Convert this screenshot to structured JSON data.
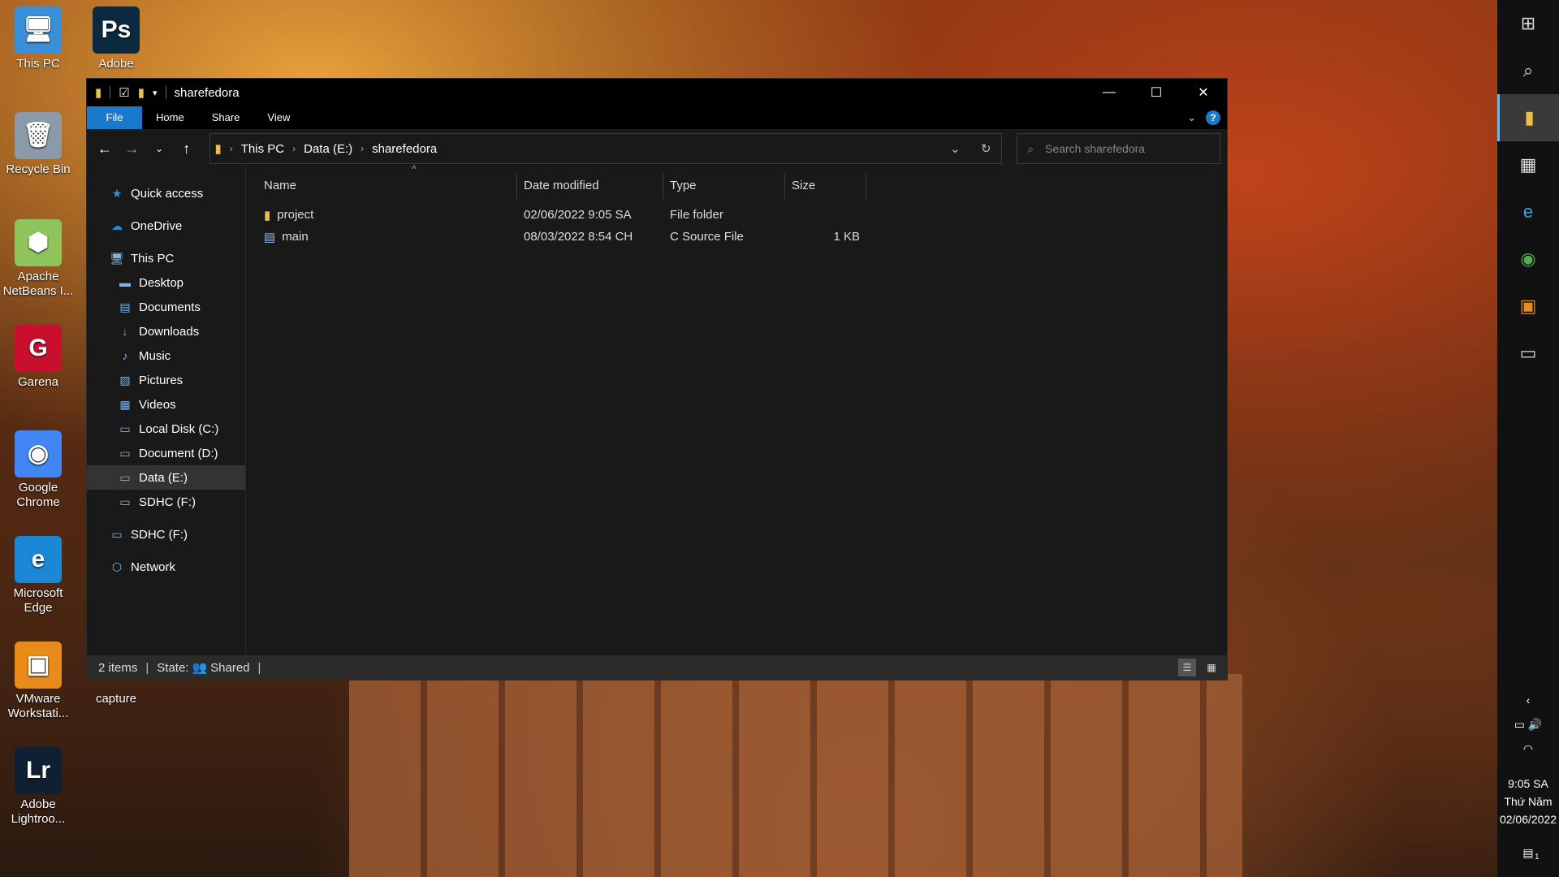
{
  "desktop": {
    "icons": [
      {
        "label": "This PC",
        "glyph": "🖥",
        "color": "#3b8fd8"
      },
      {
        "label": "Adobe",
        "glyph": "Ps",
        "color": "#0b2a3f"
      },
      {
        "label": "Recycle Bin",
        "glyph": "🗑",
        "color": "#8a9aa8"
      },
      {
        "label": "Apache NetBeans I...",
        "glyph": "⬢",
        "color": "#8fc45c"
      },
      {
        "label": "Garena",
        "glyph": "G",
        "color": "#c8102e"
      },
      {
        "label": "Google Chrome",
        "glyph": "◉",
        "color": "#4285f4"
      },
      {
        "label": "Microsoft Edge",
        "glyph": "e",
        "color": "#1b88d6"
      },
      {
        "label": "VMware Workstati...",
        "glyph": "▣",
        "color": "#e98b1a"
      },
      {
        "label": "capture",
        "glyph": "",
        "color": "transparent"
      },
      {
        "label": "Adobe Lightroo...",
        "glyph": "Lr",
        "color": "#0f2034"
      }
    ]
  },
  "window": {
    "title": "sharefedora",
    "ribbon_tabs": [
      "File",
      "Home",
      "Share",
      "View"
    ],
    "help": "?",
    "breadcrumb": [
      "This PC",
      "Data (E:)",
      "sharefedora"
    ],
    "search_placeholder": "Search sharefedora",
    "sidebar": [
      {
        "label": "Quick access",
        "icon": "★",
        "level": 1,
        "gap": false
      },
      {
        "label": "OneDrive",
        "icon": "☁",
        "level": 1,
        "gap": true
      },
      {
        "label": "This PC",
        "icon": "🖥",
        "level": 1,
        "gap": true
      },
      {
        "label": "Desktop",
        "icon": "▬",
        "level": 2,
        "gap": false
      },
      {
        "label": "Documents",
        "icon": "▤",
        "level": 2,
        "gap": false
      },
      {
        "label": "Downloads",
        "icon": "↓",
        "level": 2,
        "gap": false
      },
      {
        "label": "Music",
        "icon": "♪",
        "level": 2,
        "gap": false
      },
      {
        "label": "Pictures",
        "icon": "▨",
        "level": 2,
        "gap": false
      },
      {
        "label": "Videos",
        "icon": "▦",
        "level": 2,
        "gap": false
      },
      {
        "label": "Local Disk (C:)",
        "icon": "▭",
        "level": 2,
        "gap": false
      },
      {
        "label": "Document (D:)",
        "icon": "▭",
        "level": 2,
        "gap": false
      },
      {
        "label": "Data (E:)",
        "icon": "▭",
        "level": 2,
        "gap": false,
        "selected": true
      },
      {
        "label": "SDHC (F:)",
        "icon": "▭",
        "level": 2,
        "gap": false
      },
      {
        "label": "SDHC (F:)",
        "icon": "▭",
        "level": 1,
        "gap": true
      },
      {
        "label": "Network",
        "icon": "⬡",
        "level": 1,
        "gap": true
      }
    ],
    "columns": [
      "Name",
      "Date modified",
      "Type",
      "Size"
    ],
    "files": [
      {
        "name": "project",
        "date": "02/06/2022 9:05 SA",
        "type": "File folder",
        "size": "",
        "icon": "folder"
      },
      {
        "name": "main",
        "date": "08/03/2022 8:54 CH",
        "type": "C Source File",
        "size": "1 KB",
        "icon": "c-file"
      }
    ],
    "status": {
      "items": "2 items",
      "state_label": "State:",
      "state_value": "Shared"
    }
  },
  "taskbar": {
    "time": "9:05 SA",
    "day": "Thứ Năm",
    "date": "02/06/2022",
    "notifications": "1"
  },
  "colors": {
    "accent": "#1979ca",
    "folder": "#e9c04c"
  }
}
